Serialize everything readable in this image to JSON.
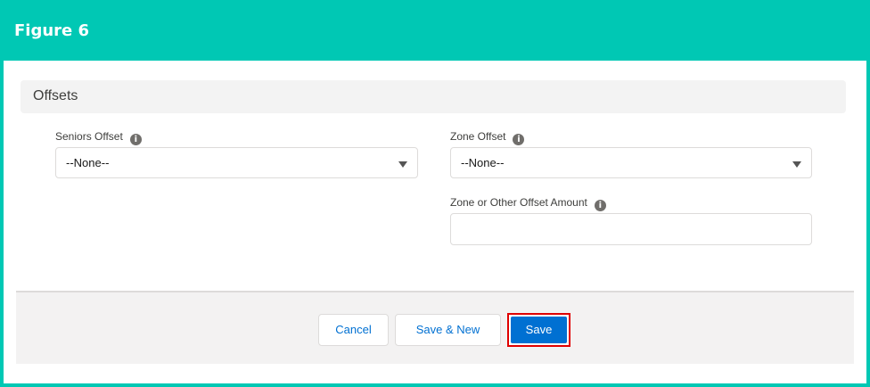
{
  "figure": {
    "title": "Figure 6"
  },
  "section": {
    "title": "Offsets"
  },
  "fields": {
    "seniors_offset": {
      "label": "Seniors Offset",
      "value": "--None--"
    },
    "zone_offset": {
      "label": "Zone Offset",
      "value": "--None--"
    },
    "zone_other_amount": {
      "label": "Zone or Other Offset Amount",
      "value": ""
    }
  },
  "icons": {
    "info": "i",
    "info_name": "info-icon",
    "dropdown_name": "chevron-down-icon"
  },
  "buttons": {
    "cancel": "Cancel",
    "save_new": "Save & New",
    "save": "Save"
  },
  "colors": {
    "frame_accent": "#00c8b4",
    "brand_button": "#0070d2",
    "highlight_box": "#e00000"
  }
}
